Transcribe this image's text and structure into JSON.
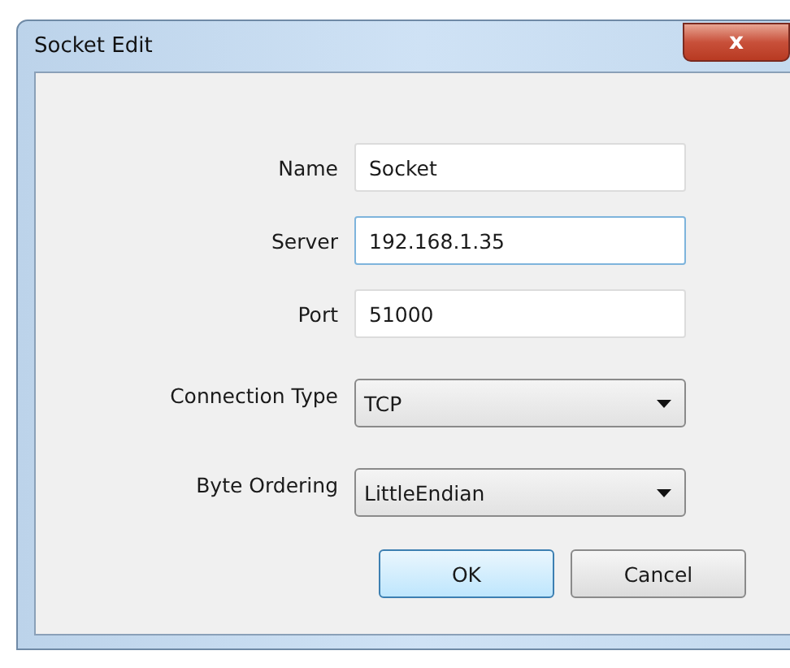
{
  "window": {
    "title": "Socket Edit",
    "close": "x"
  },
  "fields": [
    {
      "label": "Name",
      "kind": "text",
      "value": "Socket",
      "focused": false
    },
    {
      "label": "Server",
      "kind": "text",
      "value": "192.168.1.35",
      "focused": true
    },
    {
      "label": "Port",
      "kind": "text",
      "value": "51000",
      "focused": false
    },
    {
      "label": "Connection Type",
      "kind": "dropdown",
      "value": "TCP",
      "focused": false
    },
    {
      "label": "Byte Ordering",
      "kind": "dropdown",
      "value": "LittleEndian",
      "focused": false
    }
  ],
  "buttons": [
    {
      "label": "OK",
      "default": true
    },
    {
      "label": "Cancel",
      "default": false
    }
  ]
}
